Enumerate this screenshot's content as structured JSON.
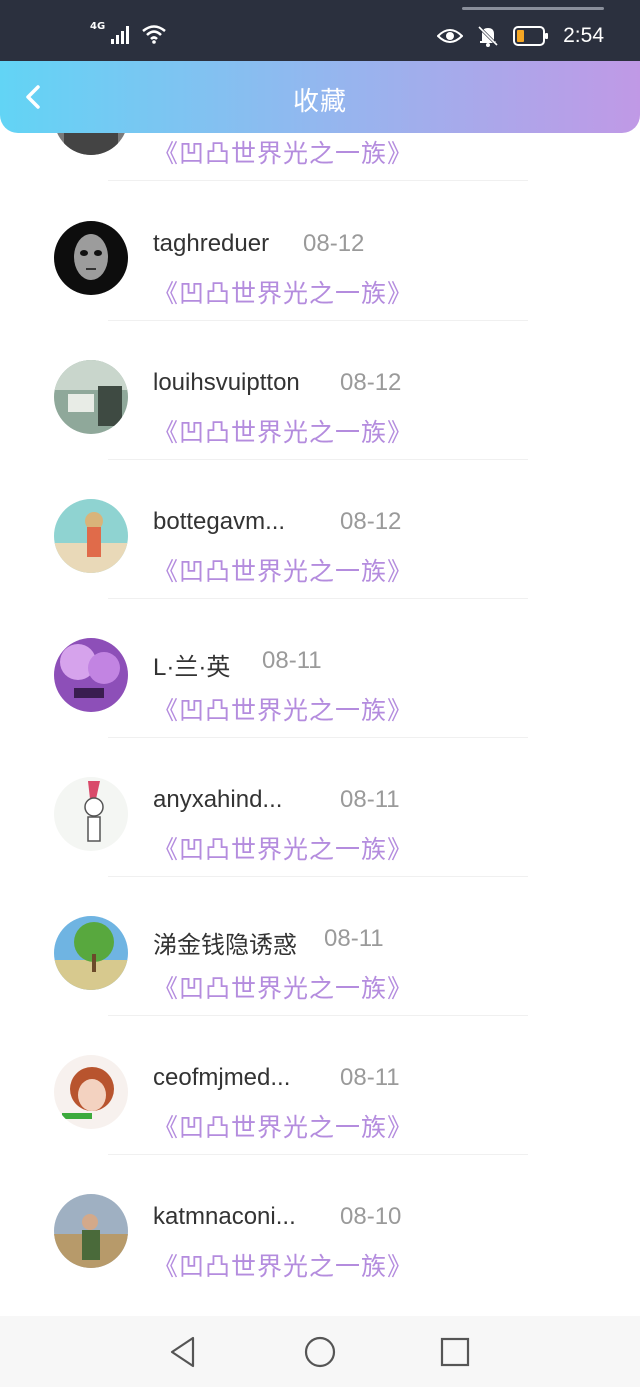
{
  "status_bar": {
    "network": "4G",
    "time": "2:54",
    "icons": [
      "signal-icon",
      "wifi-icon",
      "eye-icon",
      "bell-off-icon",
      "battery-icon"
    ]
  },
  "header": {
    "title": "收藏",
    "back_icon": "chevron-left-icon"
  },
  "colors": {
    "header_gradient": [
      "#62d4f5",
      "#c099e6"
    ],
    "book_title": "#b48cde",
    "name": "#333333",
    "date": "#9a9a9a"
  },
  "items": [
    {
      "name": "",
      "date": "",
      "book": "《凹凸世界光之一族》"
    },
    {
      "name": "taghreduer",
      "date": "08-12",
      "book": "《凹凸世界光之一族》"
    },
    {
      "name": "louihsvuiptton",
      "date": "08-12",
      "book": "《凹凸世界光之一族》"
    },
    {
      "name": "bottegavm...",
      "date": "08-12",
      "book": "《凹凸世界光之一族》"
    },
    {
      "name": "L·兰·英",
      "date": "08-11",
      "book": "《凹凸世界光之一族》"
    },
    {
      "name": "anyxahind...",
      "date": "08-11",
      "book": "《凹凸世界光之一族》"
    },
    {
      "name": "涕金钱隐诱惑",
      "date": "08-11",
      "book": "《凹凸世界光之一族》"
    },
    {
      "name": "ceofmjmed...",
      "date": "08-11",
      "book": "《凹凸世界光之一族》"
    },
    {
      "name": "katmnaconi...",
      "date": "08-10",
      "book": "《凹凸世界光之一族》"
    }
  ],
  "navbar": {
    "icons": [
      "back-triangle-icon",
      "home-circle-icon",
      "recents-square-icon"
    ]
  }
}
